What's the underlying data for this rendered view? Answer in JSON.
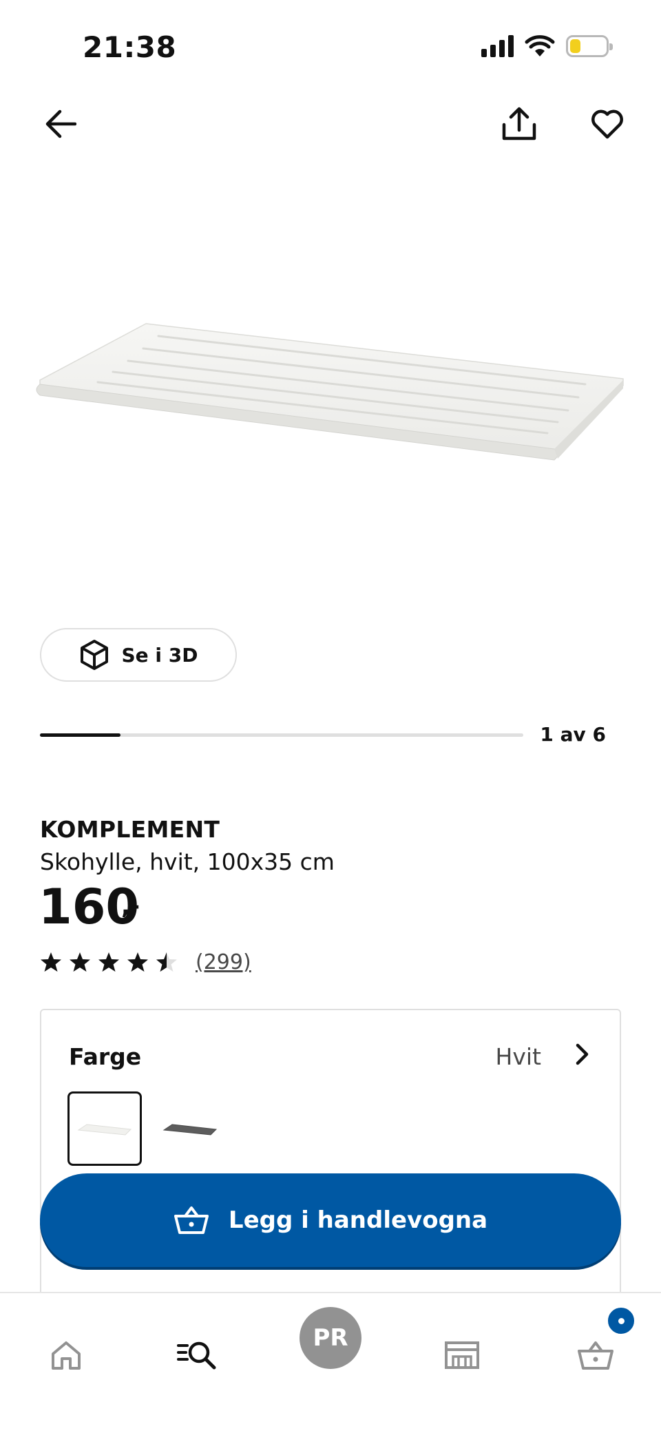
{
  "status_bar": {
    "time": "21:38",
    "signal_icon": "signal-icon",
    "wifi_icon": "wifi-icon",
    "battery_icon": "battery-icon",
    "battery_level": 0.3,
    "battery_color": "#f2cf1d"
  },
  "header": {
    "back_icon": "arrow-left-icon",
    "share_icon": "share-icon",
    "favorite_icon": "heart-icon"
  },
  "gallery": {
    "view_3d_label": "Se i 3D",
    "view_3d_icon": "cube-icon",
    "position_label": "1 av 6",
    "current": 1,
    "total": 6
  },
  "product": {
    "name": "KOMPLEMENT",
    "description": "Skohylle, hvit, 100x35 cm",
    "price": "160",
    "price_suffix": ",-",
    "rating": 4.5,
    "rating_max": 5,
    "review_count": "(299)"
  },
  "color_selector": {
    "label": "Farge",
    "selected_value": "Hvit",
    "chevron_icon": "chevron-right-icon",
    "swatches": [
      "white-shelf",
      "dark-grey-shelf"
    ]
  },
  "cart_button": {
    "label": "Legg i handlevogna",
    "icon": "basket-icon",
    "color": "#0058a3"
  },
  "bottom_nav": {
    "items": [
      "home-icon",
      "search-icon",
      "profile-avatar",
      "store-icon",
      "cart-icon"
    ],
    "avatar_initials": "PR"
  }
}
